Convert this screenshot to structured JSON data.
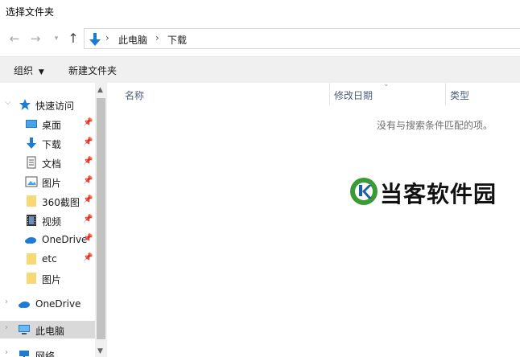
{
  "window": {
    "title": "选择文件夹"
  },
  "nav": {
    "back_icon": "arrow-left-icon",
    "forward_icon": "arrow-right-icon",
    "recent_icon": "chevron-down-icon",
    "up_icon": "arrow-up-icon"
  },
  "address": {
    "crumbs": [
      "此电脑",
      "下载"
    ],
    "separator": "›"
  },
  "commands": {
    "organize": "组织",
    "new_folder": "新建文件夹"
  },
  "sidebar": {
    "quick_access": "快速访问",
    "items": [
      {
        "label": "桌面",
        "icon": "desktop-icon"
      },
      {
        "label": "下载",
        "icon": "download-icon"
      },
      {
        "label": "文档",
        "icon": "document-icon"
      },
      {
        "label": "图片",
        "icon": "picture-icon"
      },
      {
        "label": "360截图",
        "icon": "folder-icon"
      },
      {
        "label": "视频",
        "icon": "video-icon"
      },
      {
        "label": "OneDrive",
        "icon": "onedrive-icon"
      },
      {
        "label": "etc",
        "icon": "folder-icon"
      },
      {
        "label": "图片",
        "icon": "folder-icon"
      }
    ],
    "onedrive": "OneDrive",
    "this_pc": "此电脑",
    "network": "网络"
  },
  "columns": {
    "name": "名称",
    "date": "修改日期",
    "type": "类型"
  },
  "content": {
    "empty_message": "没有与搜索条件匹配的项。"
  },
  "watermark": {
    "text": "当客软件园"
  },
  "colors": {
    "accent": "#1e7bd3",
    "folder": "#f8d775",
    "selected": "#d9d9d9",
    "watermark_green": "#3a9b35"
  }
}
